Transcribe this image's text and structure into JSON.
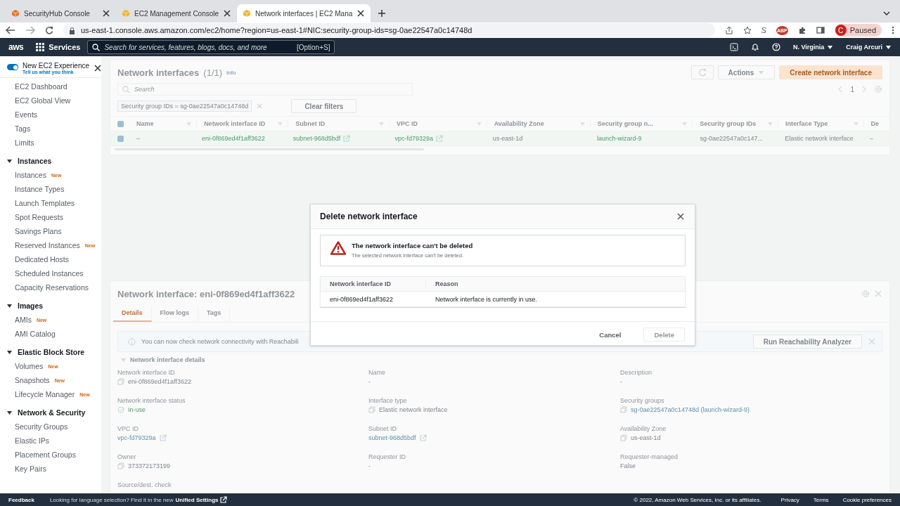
{
  "browser": {
    "tabs": [
      {
        "title": "SecurityHub Console",
        "selected": false,
        "color": "#e8742b"
      },
      {
        "title": "EC2 Management Console",
        "selected": false,
        "color": "#f0b52f"
      },
      {
        "title": "Network interfaces | EC2 Mana",
        "selected": true,
        "color": "#f0b52f"
      }
    ],
    "address": "us-east-1.console.aws.amazon.com/ec2/home?region=us-east-1#NIC:security-group-ids=sg-0ae22547a0c14748d",
    "extension_label": "S",
    "extension_badge": "ABP",
    "profile_initial": "C",
    "profile_label": "Paused"
  },
  "console_nav": {
    "logo": "aws",
    "services": "Services",
    "search_placeholder": "Search for services, features, blogs, docs, and more",
    "shortcut": "[Option+S]",
    "region": "N. Virginia",
    "user": "Craig Arcuri"
  },
  "sidebar": {
    "experience": {
      "label": "New EC2 Experience",
      "sublink": "Tell us what you think",
      "on": true
    },
    "sections": [
      {
        "items": [
          {
            "label": "EC2 Dashboard"
          },
          {
            "label": "EC2 Global View"
          },
          {
            "label": "Events"
          },
          {
            "label": "Tags"
          },
          {
            "label": "Limits"
          }
        ]
      },
      {
        "title": "Instances",
        "expanded": true,
        "items": [
          {
            "label": "Instances",
            "badge": "New"
          },
          {
            "label": "Instance Types"
          },
          {
            "label": "Launch Templates"
          },
          {
            "label": "Spot Requests"
          },
          {
            "label": "Savings Plans"
          },
          {
            "label": "Reserved Instances",
            "badge": "New"
          },
          {
            "label": "Dedicated Hosts"
          },
          {
            "label": "Scheduled Instances"
          },
          {
            "label": "Capacity Reservations"
          }
        ]
      },
      {
        "title": "Images",
        "expanded": true,
        "items": [
          {
            "label": "AMIs",
            "badge": "New"
          },
          {
            "label": "AMI Catalog"
          }
        ]
      },
      {
        "title": "Elastic Block Store",
        "expanded": true,
        "items": [
          {
            "label": "Volumes",
            "badge": "New"
          },
          {
            "label": "Snapshots",
            "badge": "New"
          },
          {
            "label": "Lifecycle Manager",
            "badge": "New"
          }
        ]
      },
      {
        "title": "Network & Security",
        "expanded": true,
        "items": [
          {
            "label": "Security Groups"
          },
          {
            "label": "Elastic IPs"
          },
          {
            "label": "Placement Groups"
          },
          {
            "label": "Key Pairs"
          }
        ]
      }
    ]
  },
  "list": {
    "title": "Network interfaces",
    "count": "(1/1)",
    "info": "Info",
    "actions": "Actions",
    "create": "Create network interface",
    "search_placeholder": "Search",
    "filter": "Security group IDs = sg-0ae22547a0c14748d",
    "clear_filters": "Clear filters",
    "page": "1",
    "all_checked": true,
    "columns": [
      "Name",
      "Network interface ID",
      "Subnet ID",
      "VPC ID",
      "Availability Zone",
      "Security group n...",
      "Security group IDs",
      "Interface Type",
      "De"
    ],
    "rows": [
      {
        "selected": true,
        "cells": [
          {
            "text": "–",
            "kind": "plain"
          },
          {
            "text": "eni-0f869ed4f1aff3622",
            "kind": "link"
          },
          {
            "text": "subnet-968d5bdf",
            "kind": "external"
          },
          {
            "text": "vpc-fd79329a",
            "kind": "external"
          },
          {
            "text": "us-east-1d",
            "kind": "plain"
          },
          {
            "text": "launch-wizard-9",
            "kind": "link"
          },
          {
            "text": "sg-0ae22547a0c147...",
            "kind": "plain"
          },
          {
            "text": "Elastic network interface",
            "kind": "plain"
          },
          {
            "text": "–",
            "kind": "plain"
          }
        ]
      }
    ]
  },
  "details": {
    "title": "Network interface: eni-0f869ed4f1aff3622",
    "tabs": [
      {
        "label": "Details",
        "selected": true
      },
      {
        "label": "Flow logs",
        "selected": false
      },
      {
        "label": "Tags",
        "selected": false
      }
    ],
    "banner": "You can now check network connectivity with Reachabili",
    "banner_button": "Run Reachability Analyzer",
    "section": "Network interface details",
    "fields": [
      {
        "label": "Network interface ID",
        "value": "eni-0f869ed4f1aff3622",
        "kind": "copy"
      },
      {
        "label": "Name",
        "value": "-",
        "kind": "plain"
      },
      {
        "label": "Description",
        "value": "-",
        "kind": "plain"
      },
      {
        "label": "Network interface status",
        "value": "In-use",
        "kind": "status"
      },
      {
        "label": "Interface type",
        "value": "Elastic network interface",
        "kind": "copy"
      },
      {
        "label": "Security groups",
        "value": "sg-0ae22547a0c14748d (launch-wizard-9)",
        "kind": "copy-link"
      },
      {
        "label": "VPC ID",
        "value": "vpc-fd79329a",
        "kind": "external"
      },
      {
        "label": "Subnet ID",
        "value": "subnet-968d5bdf",
        "kind": "external"
      },
      {
        "label": "Availability Zone",
        "value": "us-east-1d",
        "kind": "copy"
      },
      {
        "label": "Owner",
        "value": "373372173199",
        "kind": "copy"
      },
      {
        "label": "Requester ID",
        "value": "-",
        "kind": "plain"
      },
      {
        "label": "Requester-managed",
        "value": "False",
        "kind": "plain"
      },
      {
        "label": "Source/dest. check"
      }
    ]
  },
  "dialog": {
    "title": "Delete network interface",
    "alert_title": "The network interface can't be deleted",
    "alert_message": "The selected network interface can't be deleted.",
    "columns": [
      "Network interface ID",
      "Reason"
    ],
    "rows": [
      [
        "eni-0f869ed4f1aff3622",
        "Network interface is currently in use."
      ]
    ],
    "cancel": "Cancel",
    "delete": "Delete",
    "delete_disabled": true
  },
  "footer": {
    "feedback": "Feedback",
    "notice": "Looking for language selection? Find it in the new",
    "notice_link": "Unified Settings",
    "copyright": "© 2022, Amazon Web Services, Inc. or its affiliates.",
    "links": [
      "Privacy",
      "Terms",
      "Cookie preferences"
    ]
  }
}
